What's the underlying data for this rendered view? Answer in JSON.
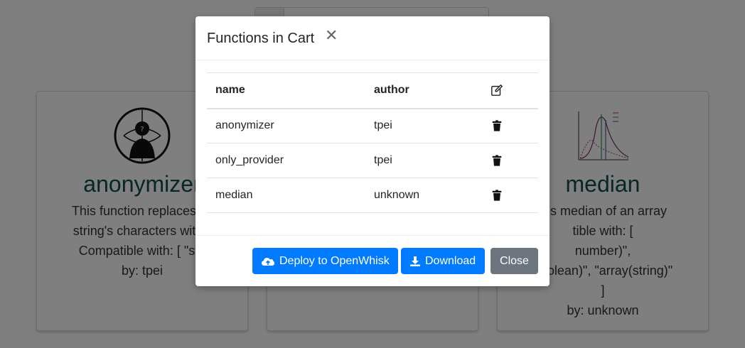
{
  "background": {
    "cards": [
      {
        "title": "anonymizer",
        "desc": [
          "This function replaces all",
          "string's characters with *",
          "Compatible with: [ \"stri"
        ],
        "by": "by: tpei",
        "icon": "anonymous-mask-logo"
      },
      {
        "title": "",
        "desc": [],
        "by": "",
        "icon": ""
      },
      {
        "title": "median",
        "desc": [
          "rns median of an array",
          "tible with: [",
          "number)\",",
          "boolean)\", \"array(string)\"",
          "]"
        ],
        "by": "by: unknown",
        "icon": "distribution-chart-logo"
      }
    ]
  },
  "modal": {
    "title": "Functions in Cart",
    "close_icon": "close-icon",
    "table": {
      "headers": [
        "name",
        "author"
      ],
      "edit_icon": "edit-icon",
      "rows": [
        {
          "name": "anonymizer",
          "author": "tpei"
        },
        {
          "name": "only_provider",
          "author": "tpei"
        },
        {
          "name": "median",
          "author": "unknown"
        }
      ],
      "delete_icon": "trash-icon"
    },
    "footer": {
      "deploy_label": "Deploy to OpenWhisk",
      "download_label": "Download",
      "close_label": "Close"
    }
  },
  "colors": {
    "primary": "#007bff",
    "secondary": "#6c757d",
    "card_title": "#0e4d4a",
    "overlay": "rgba(0,0,0,0.5)"
  }
}
